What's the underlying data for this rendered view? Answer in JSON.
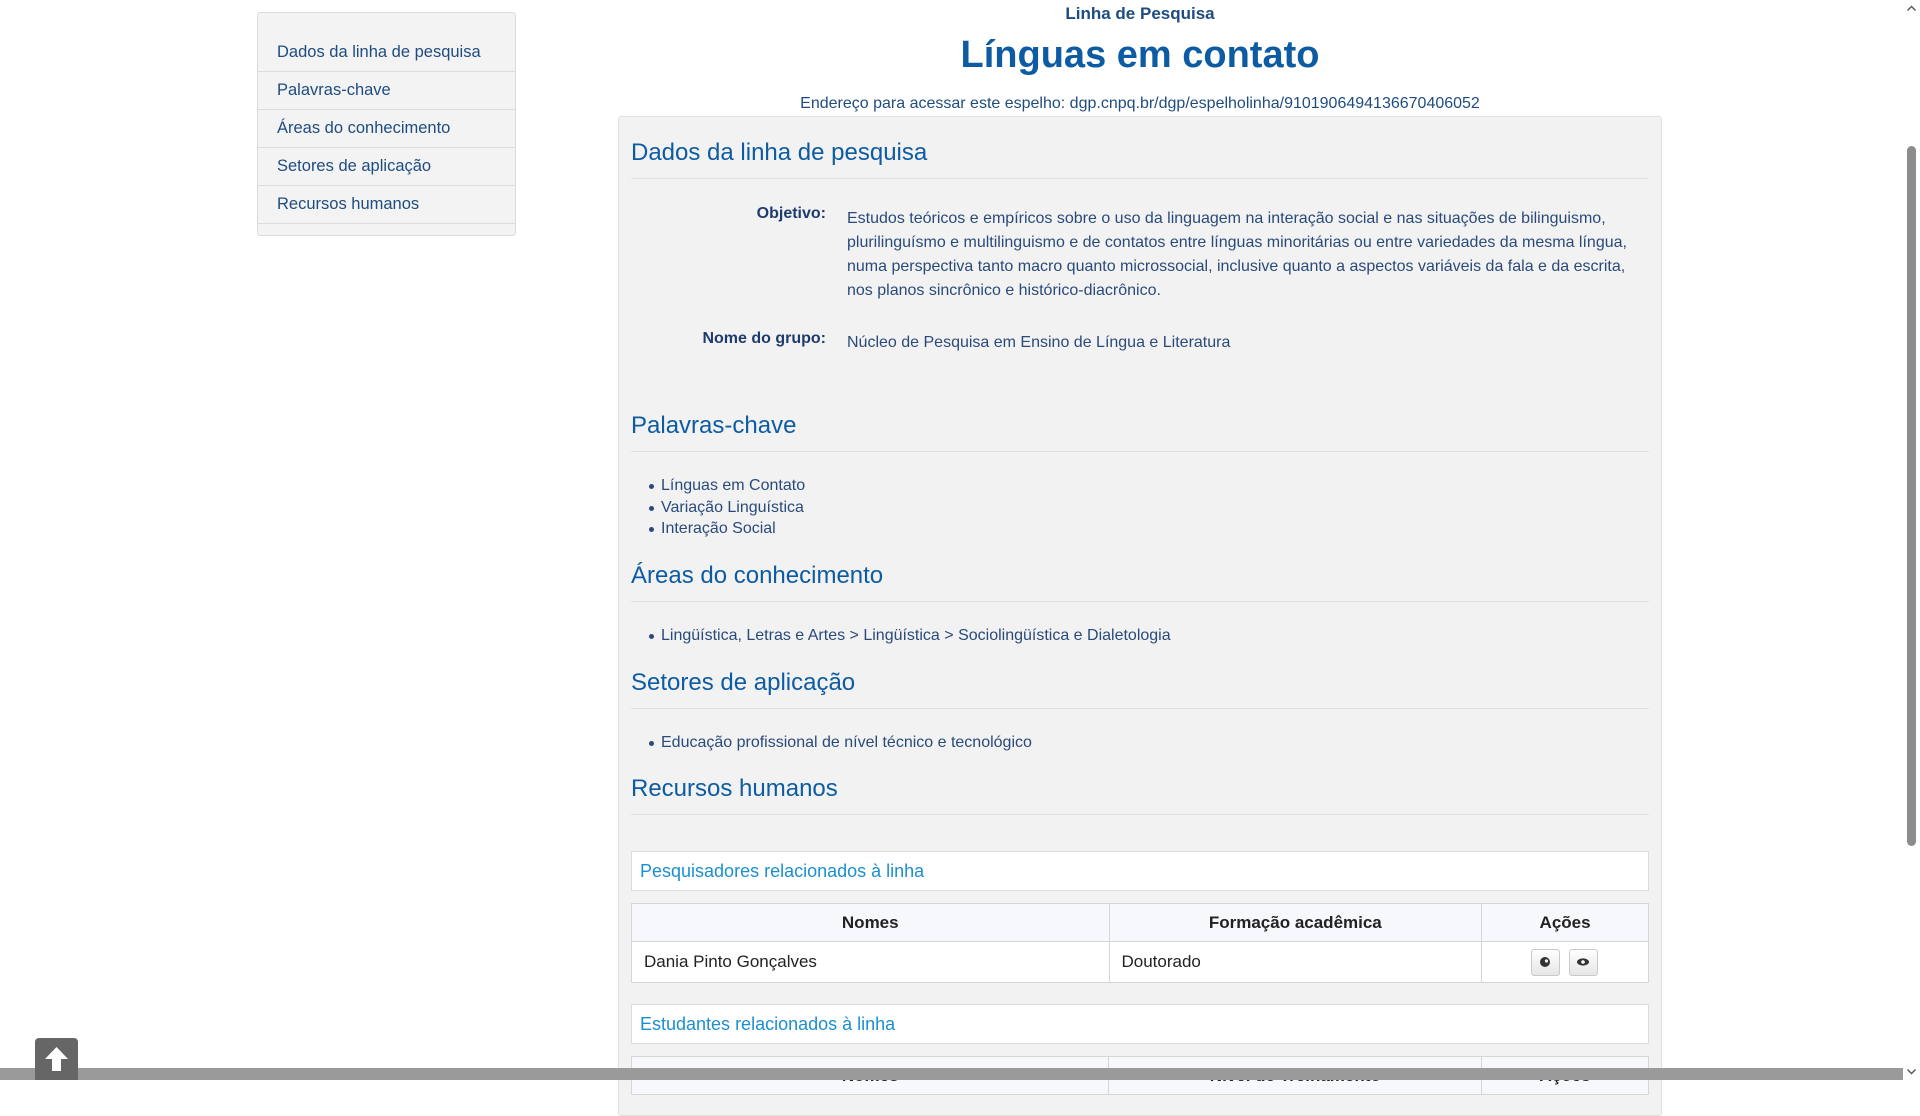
{
  "sidebar": {
    "items": [
      {
        "label": "Dados da linha de pesquisa"
      },
      {
        "label": "Palavras-chave"
      },
      {
        "label": "Áreas do conhecimento"
      },
      {
        "label": "Setores de aplicação"
      },
      {
        "label": "Recursos humanos"
      }
    ]
  },
  "header": {
    "kicker": "Linha de Pesquisa",
    "title": "Línguas em contato",
    "mirror_address": "Endereço para acessar este espelho: dgp.cnpq.br/dgp/espelholinha/9101906494136670406052"
  },
  "dados": {
    "title": "Dados da linha de pesquisa",
    "objetivo_label": "Objetivo:",
    "objetivo_lines": [
      "Estudos teóricos e empíricos sobre o uso da linguagem na interação social e nas situações de bilinguismo,",
      "plurilinguísmo e multilinguismo e de contatos entre línguas minoritárias ou entre variedades da mesma língua,",
      "numa perspectiva tanto macro quanto microssocial, inclusive quanto a aspectos variáveis da fala e da escrita,",
      "nos planos sincrônico e histórico-diacrônico."
    ],
    "grupo_label": "Nome do grupo:",
    "grupo_value": "Núcleo de Pesquisa em Ensino de Língua e Literatura"
  },
  "palavras": {
    "title": "Palavras-chave",
    "items": [
      "Línguas em Contato",
      "Variação Linguística",
      "Interação Social"
    ]
  },
  "areas": {
    "title": "Áreas do conhecimento",
    "items": [
      "Lingüística, Letras e Artes > Lingüística > Sociolingüística e Dialetologia"
    ]
  },
  "setores": {
    "title": "Setores de aplicação",
    "items": [
      "Educação profissional de nível técnico e tecnológico"
    ]
  },
  "recursos": {
    "title": "Recursos humanos",
    "pesquisadores": {
      "title": "Pesquisadores relacionados à linha",
      "headers": [
        "Nomes",
        "Formação acadêmica",
        "Ações"
      ],
      "rows": [
        {
          "nome": "Dania Pinto Gonçalves",
          "formacao": "Doutorado"
        }
      ]
    },
    "estudantes": {
      "title": "Estudantes relacionados à linha",
      "headers": [
        "Nomes",
        "Nível de Treinamento",
        "Ações"
      ]
    }
  },
  "icons": {
    "action_1": "curriculum-icon",
    "action_2": "eye-icon",
    "back_to_top": "arrow-up-icon"
  }
}
